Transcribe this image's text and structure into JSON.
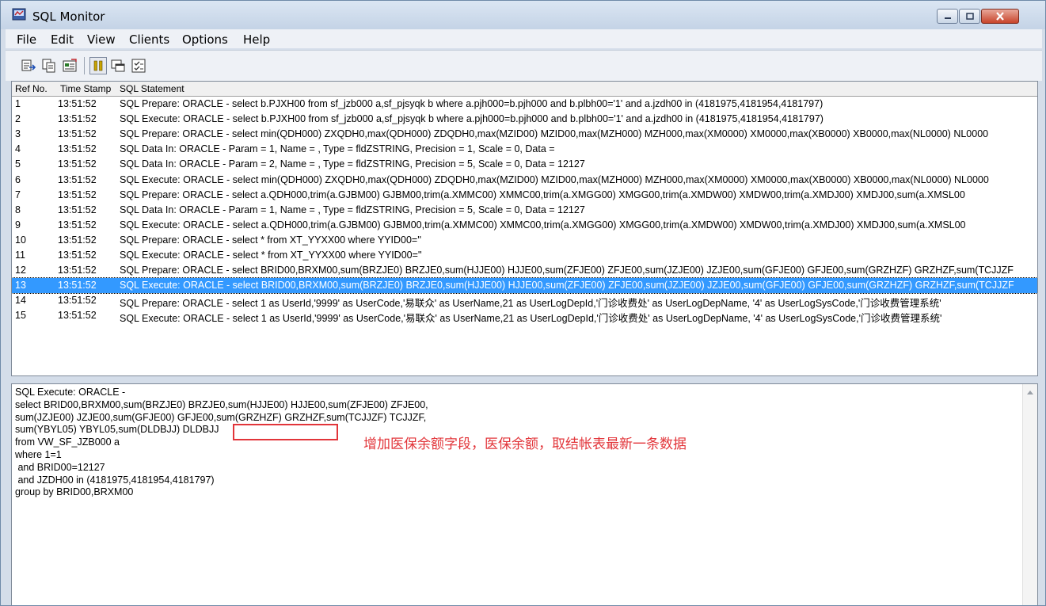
{
  "window": {
    "title": "SQL Monitor"
  },
  "menu": {
    "items": [
      "File",
      "Edit",
      "View",
      "Clients",
      "Options",
      "Help"
    ]
  },
  "toolbar": {
    "icons": [
      "save-log-icon",
      "copy-icon",
      "properties-icon",
      "pause-icon",
      "window-icon",
      "checklist-icon"
    ]
  },
  "list": {
    "headers": {
      "ref": "Ref No.",
      "timestamp": "Time Stamp",
      "sql": "SQL Statement"
    },
    "selected_index": 12,
    "rows": [
      {
        "ref": "1",
        "ts": "13:51:52",
        "sql": "SQL Prepare: ORACLE -    select b.PJXH00 from sf_jzb000 a,sf_pjsyqk b where  a.pjh000=b.pjh000 and b.plbh00='1' and a.jzdh00 in (4181975,4181954,4181797)"
      },
      {
        "ref": "2",
        "ts": "13:51:52",
        "sql": "SQL Execute: ORACLE -    select b.PJXH00 from sf_jzb000 a,sf_pjsyqk b where  a.pjh000=b.pjh000 and b.plbh00='1' and a.jzdh00 in (4181975,4181954,4181797)"
      },
      {
        "ref": "3",
        "ts": "13:51:52",
        "sql": "SQL Prepare: ORACLE - select  min(QDH000) ZXQDH0,max(QDH000) ZDQDH0,max(MZID00) MZID00,max(MZH000) MZH000,max(XM0000) XM0000,max(XB0000) XB0000,max(NL0000) NL0000"
      },
      {
        "ref": "4",
        "ts": "13:51:52",
        "sql": "SQL Data In: ORACLE - Param = 1, Name = , Type = fldZSTRING, Precision = 1, Scale = 0, Data ="
      },
      {
        "ref": "5",
        "ts": "13:51:52",
        "sql": "SQL Data In: ORACLE - Param = 2, Name = , Type = fldZSTRING, Precision = 5, Scale = 0, Data = 12127"
      },
      {
        "ref": "6",
        "ts": "13:51:52",
        "sql": "SQL Execute: ORACLE - select  min(QDH000) ZXQDH0,max(QDH000) ZDQDH0,max(MZID00) MZID00,max(MZH000) MZH000,max(XM0000) XM0000,max(XB0000) XB0000,max(NL0000) NL0000"
      },
      {
        "ref": "7",
        "ts": "13:51:52",
        "sql": "SQL Prepare: ORACLE - select  a.QDH000,trim(a.GJBM00) GJBM00,trim(a.XMMC00) XMMC00,trim(a.XMGG00) XMGG00,trim(a.XMDW00) XMDW00,trim(a.XMDJ00) XMDJ00,sum(a.XMSL00"
      },
      {
        "ref": "8",
        "ts": "13:51:52",
        "sql": "SQL Data In: ORACLE - Param = 1, Name = , Type = fldZSTRING, Precision = 5, Scale = 0, Data = 12127"
      },
      {
        "ref": "9",
        "ts": "13:51:52",
        "sql": "SQL Execute: ORACLE - select  a.QDH000,trim(a.GJBM00) GJBM00,trim(a.XMMC00) XMMC00,trim(a.XMGG00) XMGG00,trim(a.XMDW00) XMDW00,trim(a.XMDJ00) XMDJ00,sum(a.XMSL00"
      },
      {
        "ref": "10",
        "ts": "13:51:52",
        "sql": "SQL Prepare: ORACLE - select * from XT_YYXX00 where YYID00=''"
      },
      {
        "ref": "11",
        "ts": "13:51:52",
        "sql": "SQL Execute: ORACLE - select * from XT_YYXX00 where YYID00=''"
      },
      {
        "ref": "12",
        "ts": "13:51:52",
        "sql": "SQL Prepare: ORACLE - select BRID00,BRXM00,sum(BRZJE0) BRZJE0,sum(HJJE00) HJJE00,sum(ZFJE00) ZFJE00,sum(JZJE00) JZJE00,sum(GFJE00) GFJE00,sum(GRZHZF) GRZHZF,sum(TCJJZF"
      },
      {
        "ref": "13",
        "ts": "13:51:52",
        "sql": "SQL Execute: ORACLE - select BRID00,BRXM00,sum(BRZJE0) BRZJE0,sum(HJJE00) HJJE00,sum(ZFJE00) ZFJE00,sum(JZJE00) JZJE00,sum(GFJE00) GFJE00,sum(GRZHZF) GRZHZF,sum(TCJJZF"
      },
      {
        "ref": "14",
        "ts": "13:51:52",
        "sql": "SQL Prepare: ORACLE - select 1 as UserId,'9999' as UserCode,'易联众' as UserName,21 as UserLogDepId,'门诊收费处' as UserLogDepName, '4' as UserLogSysCode,'门诊收费管理系统'"
      },
      {
        "ref": "15",
        "ts": "13:51:52",
        "sql": "SQL Execute: ORACLE - select 1 as UserId,'9999' as UserCode,'易联众' as UserName,21 as UserLogDepId,'门诊收费处' as UserLogDepName, '4' as UserLogSysCode,'门诊收费管理系统'"
      }
    ]
  },
  "detail": {
    "text": "SQL Execute: ORACLE -\nselect BRID00,BRXM00,sum(BRZJE0) BRZJE0,sum(HJJE00) HJJE00,sum(ZFJE00) ZFJE00,\nsum(JZJE00) JZJE00,sum(GFJE00) GFJE00,sum(GRZHZF) GRZHZF,sum(TCJJZF) TCJJZF,\nsum(YBYL05) YBYL05,sum(DLDBJJ) DLDBJJ\nfrom VW_SF_JZB000 a\nwhere 1=1\n and BRID00=12127\n and JZDH00 in (4181975,4181954,4181797)\ngroup by BRID00,BRXM00"
  },
  "annotation": {
    "text": "增加医保余额字段，医保余额，取结帐表最新一条数据",
    "color": "#e2353a"
  },
  "colors": {
    "selection": "#3399ff",
    "annotation": "#e2353a"
  }
}
